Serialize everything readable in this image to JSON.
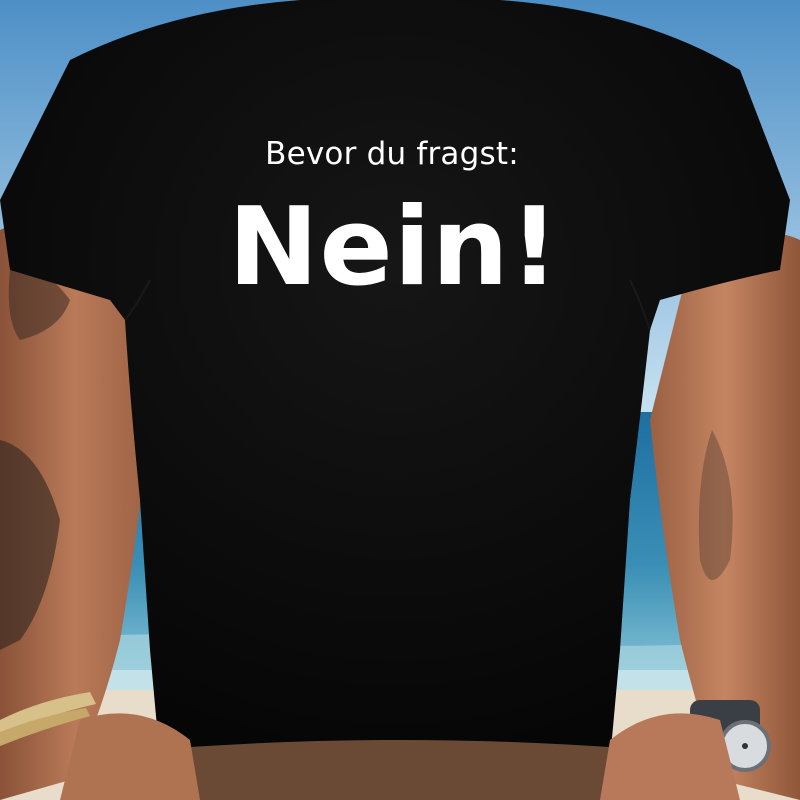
{
  "print": {
    "line1": "Bevor du fragst:",
    "line2": "Nein!"
  },
  "colors": {
    "sky_top": "#4d8fc6",
    "sky_bottom": "#c9e2f2",
    "sea_far": "#1d6fa1",
    "sea_near": "#6fb3cc",
    "sand": "#e8dccb",
    "shirt": "#0b0b0b",
    "skin": "#b67757",
    "print_text": "#ffffff"
  }
}
